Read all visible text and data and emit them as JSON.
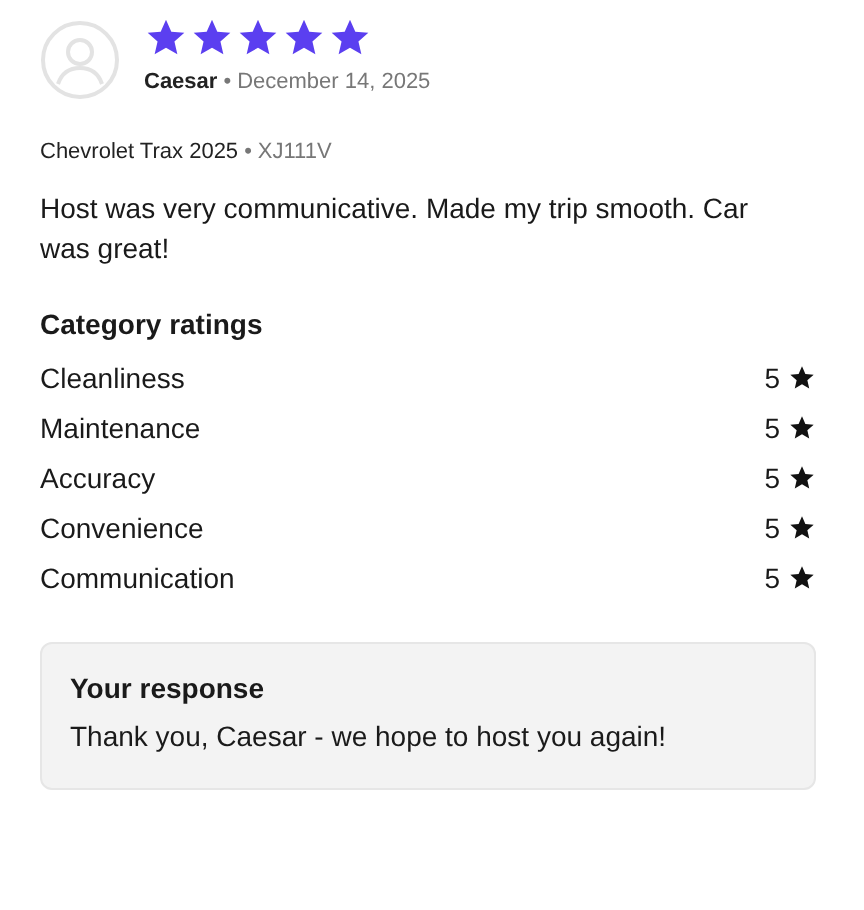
{
  "review": {
    "stars": 5,
    "reviewer": "Caesar",
    "separator": "•",
    "date": "December 14, 2025",
    "vehicle": "Chevrolet Trax 2025",
    "vehicle_separator": "•",
    "plate": "XJ111V",
    "text": "Host was very communicative. Made my trip smooth. Car was great!"
  },
  "category_ratings": {
    "title": "Category ratings",
    "items": [
      {
        "label": "Cleanliness",
        "rating": "5"
      },
      {
        "label": "Maintenance",
        "rating": "5"
      },
      {
        "label": "Accuracy",
        "rating": "5"
      },
      {
        "label": "Convenience",
        "rating": "5"
      },
      {
        "label": "Communication",
        "rating": "5"
      }
    ]
  },
  "response": {
    "title": "Your response",
    "text": "Thank you, Caesar - we hope to host you again!"
  }
}
